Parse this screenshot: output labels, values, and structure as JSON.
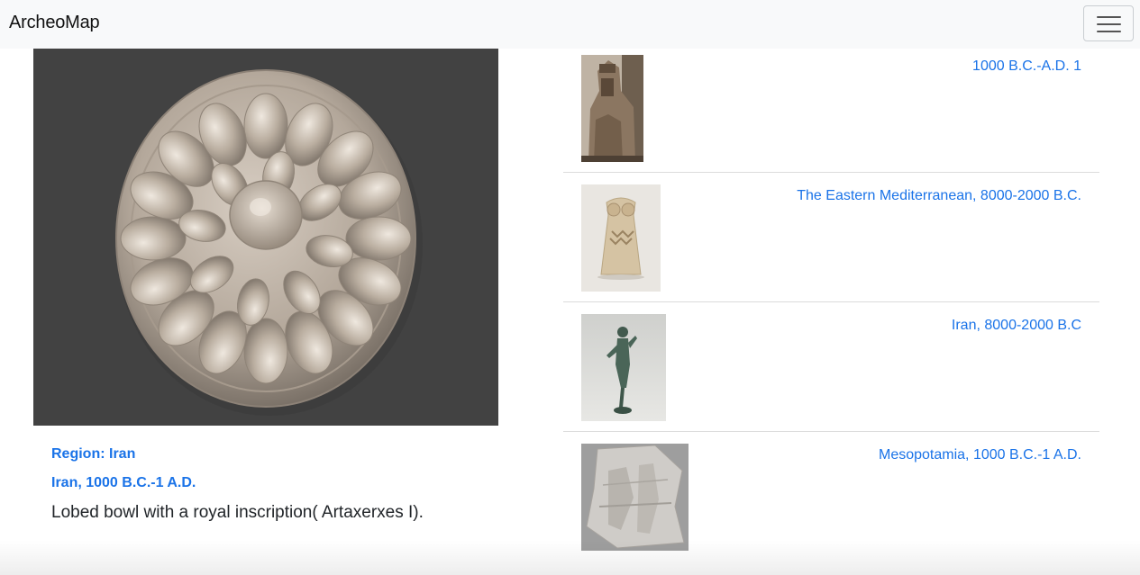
{
  "navbar": {
    "brand": "ArcheoMap",
    "menu_icon": "hamburger-icon"
  },
  "featured": {
    "image": "lobed-silver-bowl",
    "region_label": "Region: Iran",
    "period_label": "Iran, 1000 B.C.-1 A.D.",
    "title": "Lobed bowl with a royal inscription( Artaxerxes I)."
  },
  "list": [
    {
      "thumb": "lamassu-relief",
      "label": "1000 B.C.-A.D. 1"
    },
    {
      "thumb": "stone-idol",
      "label": "The Eastern Mediterranean, 8000-2000 B.C."
    },
    {
      "thumb": "bronze-figure",
      "label": "Iran, 8000-2000 B.C"
    },
    {
      "thumb": "stone-relief-fragment",
      "label": "Mesopotamia, 1000 B.C.-1 A.D."
    }
  ],
  "colors": {
    "link": "#1a73e8",
    "navbar_bg": "#f8f9fa",
    "featured_bg": "#424242"
  }
}
